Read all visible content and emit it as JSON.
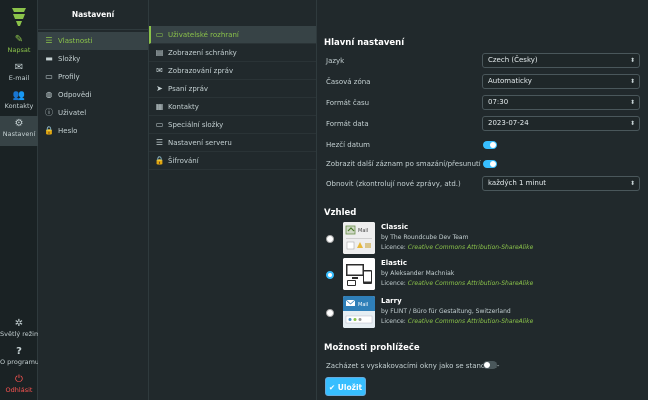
{
  "rail": {
    "compose": "Napsat",
    "mail": "E-mail",
    "contacts": "Kontakty",
    "settings": "Nastavení",
    "light_mode": "Světlý režim",
    "about": "O programu",
    "logout": "Odhlásit"
  },
  "settings": {
    "title": "Nastavení",
    "items": [
      "Vlastnosti",
      "Složky",
      "Profily",
      "Odpovědi",
      "Uživatel",
      "Heslo"
    ]
  },
  "sections": {
    "items": [
      "Uživatelské rozhraní",
      "Zobrazení schránky",
      "Zobrazování zpráv",
      "Psaní zpráv",
      "Kontakty",
      "Speciální složky",
      "Nastavení serveru",
      "Šifrování"
    ]
  },
  "main": {
    "general_title": "Hlavní nastavení",
    "language_label": "Jazyk",
    "language_value": "Czech (Česky)",
    "timezone_label": "Časová zóna",
    "timezone_value": "Automaticky",
    "time_format_label": "Formát času",
    "time_format_value": "07:30",
    "date_format_label": "Formát data",
    "date_format_value": "2023-07-24",
    "pretty_date_label": "Hezčí datum",
    "next_after_delete_label": "Zobrazit další záznam po smazání/přesunutí",
    "refresh_label": "Obnovit (zkontrolují nové zprávy, atd.)",
    "refresh_value": "každých 1 minut",
    "appearance_title": "Vzhled",
    "skins": [
      {
        "name": "Classic",
        "by": "by The Roundcube Dev Team",
        "lic_prefix": "Licence:",
        "lic": "Creative Commons Attribution-ShareAlike"
      },
      {
        "name": "Elastic",
        "by": "by Aleksander Machniak",
        "lic_prefix": "Licence:",
        "lic": "Creative Commons Attribution-ShareAlike"
      },
      {
        "name": "Larry",
        "by": "by FLINT / Büro für Gestaltung, Switzerland",
        "lic_prefix": "Licence:",
        "lic": "Creative Commons Attribution-ShareAlike"
      }
    ],
    "browser_title": "Možnosti prohlížeče",
    "popup_label": "Zacházet s vyskakovacími okny jako se standard-",
    "save": "Uložit"
  },
  "colors": {
    "accent": "#37beff",
    "active_green": "#8bc34a",
    "logout": "#ff5552"
  }
}
